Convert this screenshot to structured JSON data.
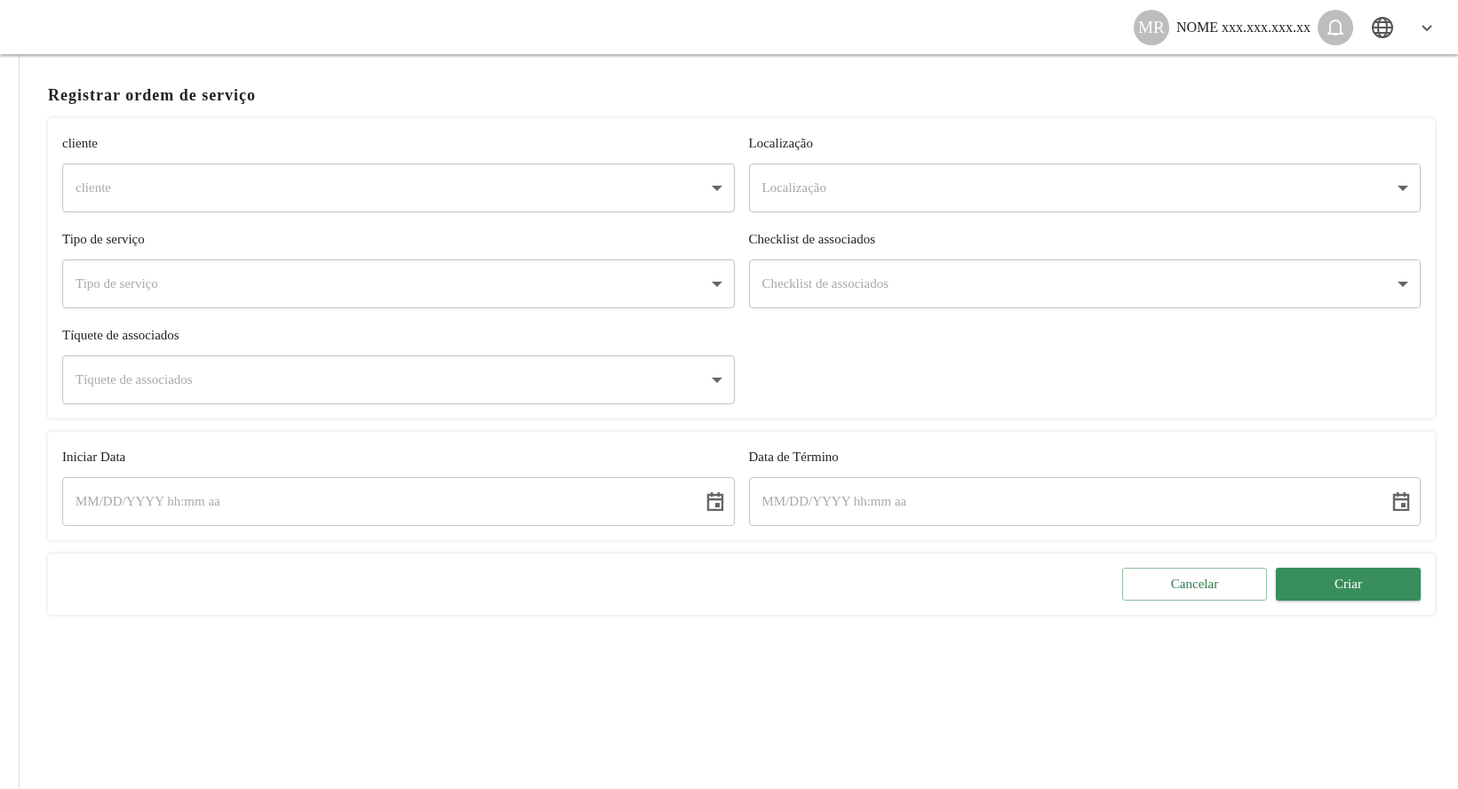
{
  "header": {
    "avatar_initials": "MR",
    "user_name": "NOME xxx.xxx.xxx.xx"
  },
  "page_title": "Registrar ordem de serviço",
  "sections": [
    {
      "fields": [
        {
          "kind": "select",
          "label": "cliente",
          "placeholder": "cliente"
        },
        {
          "kind": "select",
          "label": "Localização",
          "placeholder": "Localização"
        },
        {
          "kind": "select",
          "label": "Tipo de serviço",
          "placeholder": "Tipo de serviço"
        },
        {
          "kind": "select",
          "label": "Checklist de associados",
          "placeholder": "Checklist de associados"
        },
        {
          "kind": "select",
          "label": "Tíquete de associados",
          "placeholder": "Tíquete de associados"
        }
      ]
    },
    {
      "fields": [
        {
          "kind": "date",
          "label": "Iniciar Data",
          "placeholder": "MM/DD/YYYY hh:mm aa"
        },
        {
          "kind": "date",
          "label": "Data de Término",
          "placeholder": "MM/DD/YYYY hh:mm aa"
        }
      ]
    }
  ],
  "buttons": [
    {
      "kind": "secondary",
      "label": "Cancelar"
    },
    {
      "kind": "primary",
      "label": "Criar"
    }
  ]
}
